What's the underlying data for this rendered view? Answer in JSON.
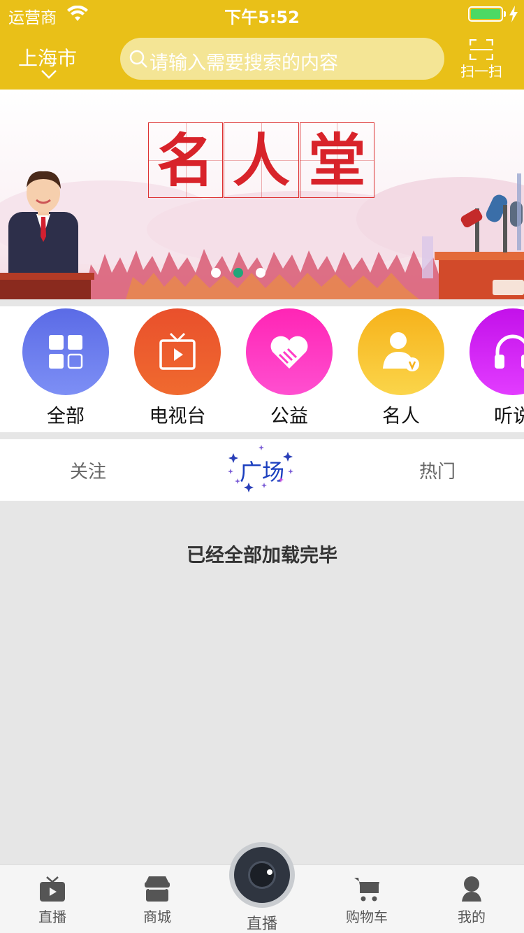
{
  "status_bar": {
    "carrier": "运营商",
    "time": "下午5:52"
  },
  "header": {
    "city": "上海市",
    "search_placeholder": "请输入需要搜索的内容",
    "scan_label": "扫一扫"
  },
  "banner": {
    "title_chars": [
      "名",
      "人",
      "堂"
    ],
    "active_slide": 2,
    "slide_count": 3
  },
  "categories": [
    {
      "label": "全部",
      "icon": "grid-icon",
      "color_top": "#5b6be6",
      "color_bottom": "#7d8ff5"
    },
    {
      "label": "电视台",
      "icon": "tv-icon",
      "color_top": "#e9502c",
      "color_bottom": "#f06a2f"
    },
    {
      "label": "公益",
      "icon": "heart-hands-icon",
      "color_top": "#ff25b5",
      "color_bottom": "#ff4fd0"
    },
    {
      "label": "名人",
      "icon": "verified-person-icon",
      "color_top": "#f6b21b",
      "color_bottom": "#fbd54a"
    },
    {
      "label": "听说",
      "icon": "headphones-icon",
      "color_top": "#c311ea",
      "color_bottom": "#e23cff"
    }
  ],
  "tabs": [
    {
      "label": "关注",
      "active": false
    },
    {
      "label": "广场",
      "active": true
    },
    {
      "label": "热门",
      "active": false
    }
  ],
  "feed_status": "已经全部加载完毕",
  "bottom_nav": [
    {
      "label": "直播",
      "icon": "tv-play-icon"
    },
    {
      "label": "商城",
      "icon": "store-icon"
    },
    {
      "label": "直播",
      "icon": "camera-lens-icon"
    },
    {
      "label": "购物车",
      "icon": "cart-icon"
    },
    {
      "label": "我的",
      "icon": "person-icon"
    }
  ],
  "colors": {
    "header": "#e9c018",
    "accent_green": "#21a67a",
    "tab_active": "#1b3fbf"
  }
}
